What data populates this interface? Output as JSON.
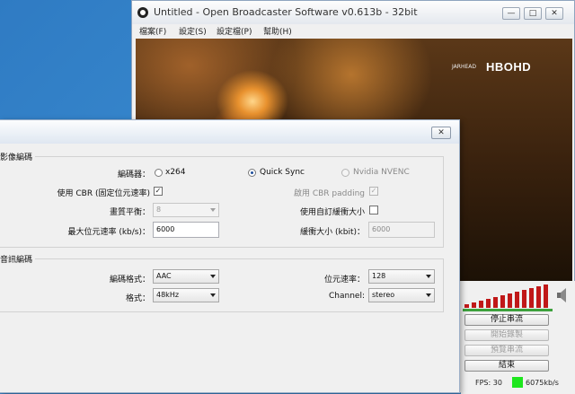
{
  "obs": {
    "title": "Untitled - Open Broadcaster Software v0.613b - 32bit",
    "window_buttons": [
      "—",
      "□",
      "✕"
    ],
    "menu": [
      "檔案(F)",
      "設定(S)",
      "設定檔(P)",
      "幫助(H)"
    ],
    "video": {
      "channel_logo": "HBOHD",
      "channel_small": "JARHEAD"
    },
    "buttons": {
      "stop_stream": "停止串流",
      "start_record": "開始錄製",
      "preview_stream": "預覽串流",
      "exit": "結束"
    },
    "status": {
      "fps": "FPS: 30",
      "bitrate": "6075kb/s",
      "indicator_color": "#1ee61e"
    }
  },
  "dialog": {
    "close_label": "✕",
    "video_group": {
      "title": "影像編碼",
      "encoder_label": "編碼器：",
      "encoders": [
        {
          "label": "x264",
          "selected": false,
          "enabled": true
        },
        {
          "label": "Quick Sync",
          "selected": true,
          "enabled": true
        },
        {
          "label": "Nvidia NVENC",
          "selected": false,
          "enabled": false
        }
      ],
      "cbr_label": "使用 CBR (固定位元速率)",
      "cbr_checked": "✓",
      "cbr_padding_label": "啟用 CBR padding",
      "cbr_padding_checked": "✓",
      "quality_label": "畫質平衡：",
      "quality_value": "8",
      "custom_buffer_label": "使用自訂緩衝大小",
      "max_bitrate_label": "最大位元速率 (kb/s)：",
      "max_bitrate_value": "6000",
      "buffer_size_label": "緩衝大小 (kbit)：",
      "buffer_size_value": "6000"
    },
    "audio_group": {
      "title": "音訊編碼",
      "codec_label": "編碼格式：",
      "codec_value": "AAC",
      "bitrate_label": "位元速率：",
      "bitrate_value": "128",
      "format_label": "格式：",
      "format_value": "48kHz",
      "channel_label": "Channel:",
      "channel_value": "stereo"
    }
  }
}
